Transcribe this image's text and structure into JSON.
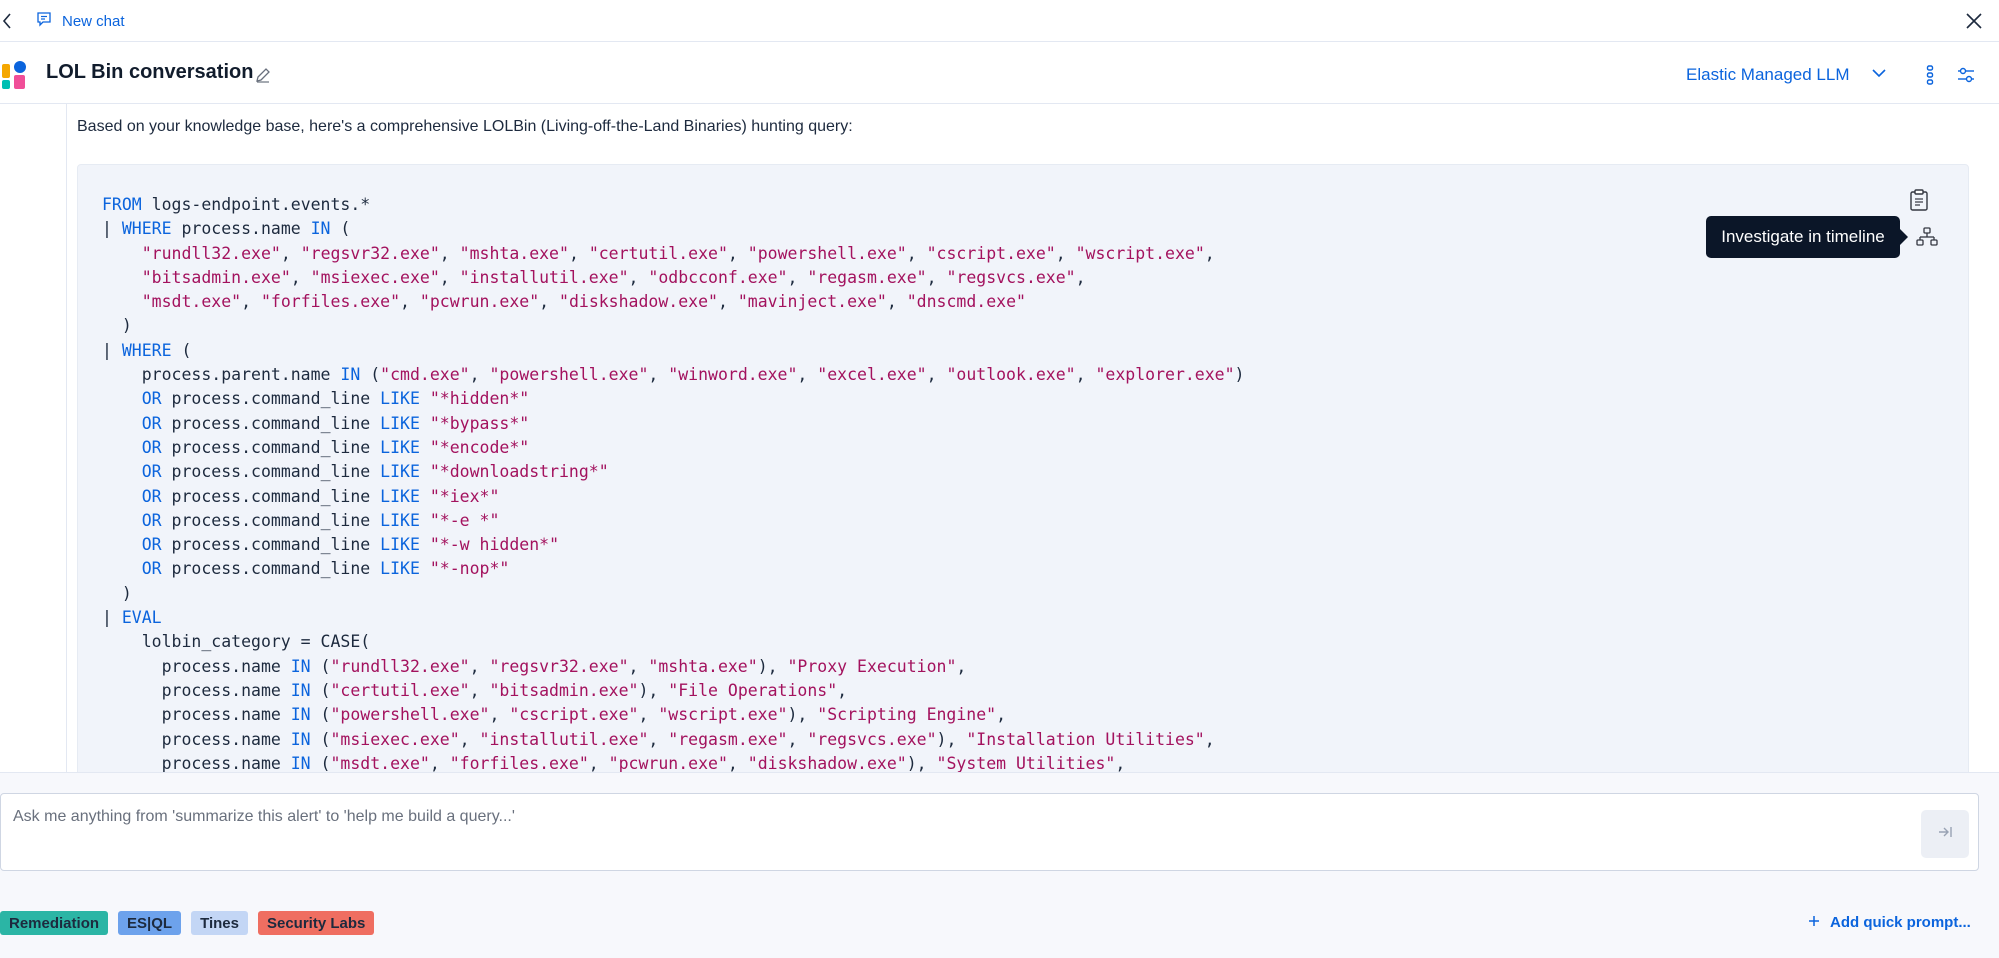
{
  "topbar": {
    "new_chat_label": "New chat"
  },
  "header": {
    "conversation_title": "LOL Bin conversation",
    "model_label": "Elastic Managed LLM"
  },
  "message": {
    "intro": "Based on your knowledge base, here's a comprehensive LOLBin (Living-off-the-Land Binaries) hunting query:",
    "code_lines": [
      [
        [
          "kw",
          "FROM"
        ],
        [
          "t",
          " logs-endpoint.events.*"
        ]
      ],
      [
        [
          "t",
          "| "
        ],
        [
          "kw",
          "WHERE"
        ],
        [
          "t",
          " process.name "
        ],
        [
          "kw",
          "IN"
        ],
        [
          "t",
          " ("
        ]
      ],
      [
        [
          "t",
          "    "
        ],
        [
          "str",
          "\"rundll32.exe\""
        ],
        [
          "t",
          ", "
        ],
        [
          "str",
          "\"regsvr32.exe\""
        ],
        [
          "t",
          ", "
        ],
        [
          "str",
          "\"mshta.exe\""
        ],
        [
          "t",
          ", "
        ],
        [
          "str",
          "\"certutil.exe\""
        ],
        [
          "t",
          ", "
        ],
        [
          "str",
          "\"powershell.exe\""
        ],
        [
          "t",
          ", "
        ],
        [
          "str",
          "\"cscript.exe\""
        ],
        [
          "t",
          ", "
        ],
        [
          "str",
          "\"wscript.exe\""
        ],
        [
          "t",
          ","
        ]
      ],
      [
        [
          "t",
          "    "
        ],
        [
          "str",
          "\"bitsadmin.exe\""
        ],
        [
          "t",
          ", "
        ],
        [
          "str",
          "\"msiexec.exe\""
        ],
        [
          "t",
          ", "
        ],
        [
          "str",
          "\"installutil.exe\""
        ],
        [
          "t",
          ", "
        ],
        [
          "str",
          "\"odbcconf.exe\""
        ],
        [
          "t",
          ", "
        ],
        [
          "str",
          "\"regasm.exe\""
        ],
        [
          "t",
          ", "
        ],
        [
          "str",
          "\"regsvcs.exe\""
        ],
        [
          "t",
          ","
        ]
      ],
      [
        [
          "t",
          "    "
        ],
        [
          "str",
          "\"msdt.exe\""
        ],
        [
          "t",
          ", "
        ],
        [
          "str",
          "\"forfiles.exe\""
        ],
        [
          "t",
          ", "
        ],
        [
          "str",
          "\"pcwrun.exe\""
        ],
        [
          "t",
          ", "
        ],
        [
          "str",
          "\"diskshadow.exe\""
        ],
        [
          "t",
          ", "
        ],
        [
          "str",
          "\"mavinject.exe\""
        ],
        [
          "t",
          ", "
        ],
        [
          "str",
          "\"dnscmd.exe\""
        ]
      ],
      [
        [
          "t",
          "  )"
        ]
      ],
      [
        [
          "t",
          "| "
        ],
        [
          "kw",
          "WHERE"
        ],
        [
          "t",
          " ("
        ]
      ],
      [
        [
          "t",
          "    process.parent.name "
        ],
        [
          "kw",
          "IN"
        ],
        [
          "t",
          " ("
        ],
        [
          "str",
          "\"cmd.exe\""
        ],
        [
          "t",
          ", "
        ],
        [
          "str",
          "\"powershell.exe\""
        ],
        [
          "t",
          ", "
        ],
        [
          "str",
          "\"winword.exe\""
        ],
        [
          "t",
          ", "
        ],
        [
          "str",
          "\"excel.exe\""
        ],
        [
          "t",
          ", "
        ],
        [
          "str",
          "\"outlook.exe\""
        ],
        [
          "t",
          ", "
        ],
        [
          "str",
          "\"explorer.exe\""
        ],
        [
          "t",
          ")"
        ]
      ],
      [
        [
          "t",
          "    "
        ],
        [
          "kw",
          "OR"
        ],
        [
          "t",
          " process.command_line "
        ],
        [
          "kw",
          "LIKE"
        ],
        [
          "t",
          " "
        ],
        [
          "str",
          "\"*hidden*\""
        ]
      ],
      [
        [
          "t",
          "    "
        ],
        [
          "kw",
          "OR"
        ],
        [
          "t",
          " process.command_line "
        ],
        [
          "kw",
          "LIKE"
        ],
        [
          "t",
          " "
        ],
        [
          "str",
          "\"*bypass*\""
        ]
      ],
      [
        [
          "t",
          "    "
        ],
        [
          "kw",
          "OR"
        ],
        [
          "t",
          " process.command_line "
        ],
        [
          "kw",
          "LIKE"
        ],
        [
          "t",
          " "
        ],
        [
          "str",
          "\"*encode*\""
        ]
      ],
      [
        [
          "t",
          "    "
        ],
        [
          "kw",
          "OR"
        ],
        [
          "t",
          " process.command_line "
        ],
        [
          "kw",
          "LIKE"
        ],
        [
          "t",
          " "
        ],
        [
          "str",
          "\"*downloadstring*\""
        ]
      ],
      [
        [
          "t",
          "    "
        ],
        [
          "kw",
          "OR"
        ],
        [
          "t",
          " process.command_line "
        ],
        [
          "kw",
          "LIKE"
        ],
        [
          "t",
          " "
        ],
        [
          "str",
          "\"*iex*\""
        ]
      ],
      [
        [
          "t",
          "    "
        ],
        [
          "kw",
          "OR"
        ],
        [
          "t",
          " process.command_line "
        ],
        [
          "kw",
          "LIKE"
        ],
        [
          "t",
          " "
        ],
        [
          "str",
          "\"*-e *\""
        ]
      ],
      [
        [
          "t",
          "    "
        ],
        [
          "kw",
          "OR"
        ],
        [
          "t",
          " process.command_line "
        ],
        [
          "kw",
          "LIKE"
        ],
        [
          "t",
          " "
        ],
        [
          "str",
          "\"*-w hidden*\""
        ]
      ],
      [
        [
          "t",
          "    "
        ],
        [
          "kw",
          "OR"
        ],
        [
          "t",
          " process.command_line "
        ],
        [
          "kw",
          "LIKE"
        ],
        [
          "t",
          " "
        ],
        [
          "str",
          "\"*-nop*\""
        ]
      ],
      [
        [
          "t",
          "  )"
        ]
      ],
      [
        [
          "t",
          "| "
        ],
        [
          "kw",
          "EVAL"
        ]
      ],
      [
        [
          "t",
          "    lolbin_category = CASE("
        ]
      ],
      [
        [
          "t",
          "      process.name "
        ],
        [
          "kw",
          "IN"
        ],
        [
          "t",
          " ("
        ],
        [
          "str",
          "\"rundll32.exe\""
        ],
        [
          "t",
          ", "
        ],
        [
          "str",
          "\"regsvr32.exe\""
        ],
        [
          "t",
          ", "
        ],
        [
          "str",
          "\"mshta.exe\""
        ],
        [
          "t",
          "), "
        ],
        [
          "str",
          "\"Proxy Execution\""
        ],
        [
          "t",
          ","
        ]
      ],
      [
        [
          "t",
          "      process.name "
        ],
        [
          "kw",
          "IN"
        ],
        [
          "t",
          " ("
        ],
        [
          "str",
          "\"certutil.exe\""
        ],
        [
          "t",
          ", "
        ],
        [
          "str",
          "\"bitsadmin.exe\""
        ],
        [
          "t",
          "), "
        ],
        [
          "str",
          "\"File Operations\""
        ],
        [
          "t",
          ","
        ]
      ],
      [
        [
          "t",
          "      process.name "
        ],
        [
          "kw",
          "IN"
        ],
        [
          "t",
          " ("
        ],
        [
          "str",
          "\"powershell.exe\""
        ],
        [
          "t",
          ", "
        ],
        [
          "str",
          "\"cscript.exe\""
        ],
        [
          "t",
          ", "
        ],
        [
          "str",
          "\"wscript.exe\""
        ],
        [
          "t",
          "), "
        ],
        [
          "str",
          "\"Scripting Engine\""
        ],
        [
          "t",
          ","
        ]
      ],
      [
        [
          "t",
          "      process.name "
        ],
        [
          "kw",
          "IN"
        ],
        [
          "t",
          " ("
        ],
        [
          "str",
          "\"msiexec.exe\""
        ],
        [
          "t",
          ", "
        ],
        [
          "str",
          "\"installutil.exe\""
        ],
        [
          "t",
          ", "
        ],
        [
          "str",
          "\"regasm.exe\""
        ],
        [
          "t",
          ", "
        ],
        [
          "str",
          "\"regsvcs.exe\""
        ],
        [
          "t",
          "), "
        ],
        [
          "str",
          "\"Installation Utilities\""
        ],
        [
          "t",
          ","
        ]
      ],
      [
        [
          "t",
          "      process.name "
        ],
        [
          "kw",
          "IN"
        ],
        [
          "t",
          " ("
        ],
        [
          "str",
          "\"msdt.exe\""
        ],
        [
          "t",
          ", "
        ],
        [
          "str",
          "\"forfiles.exe\""
        ],
        [
          "t",
          ", "
        ],
        [
          "str",
          "\"pcwrun.exe\""
        ],
        [
          "t",
          ", "
        ],
        [
          "str",
          "\"diskshadow.exe\""
        ],
        [
          "t",
          "), "
        ],
        [
          "str",
          "\"System Utilities\""
        ],
        [
          "t",
          ","
        ]
      ]
    ],
    "tooltip": "Investigate in timeline"
  },
  "prompt": {
    "placeholder": "Ask me anything from 'summarize this alert' to 'help me build a query...'"
  },
  "quick_prompts": [
    {
      "label": "Remediation",
      "color": "#2bb5a5"
    },
    {
      "label": "ES|QL",
      "color": "#6da2ec"
    },
    {
      "label": "Tines",
      "color": "#c3d6f5"
    },
    {
      "label": "Security Labs",
      "color": "#ef6e61"
    }
  ],
  "add_prompt_label": "Add quick prompt...",
  "colors": {
    "accent": "#0b64dd",
    "keyword": "#0b64dd",
    "string": "#a3125e"
  }
}
